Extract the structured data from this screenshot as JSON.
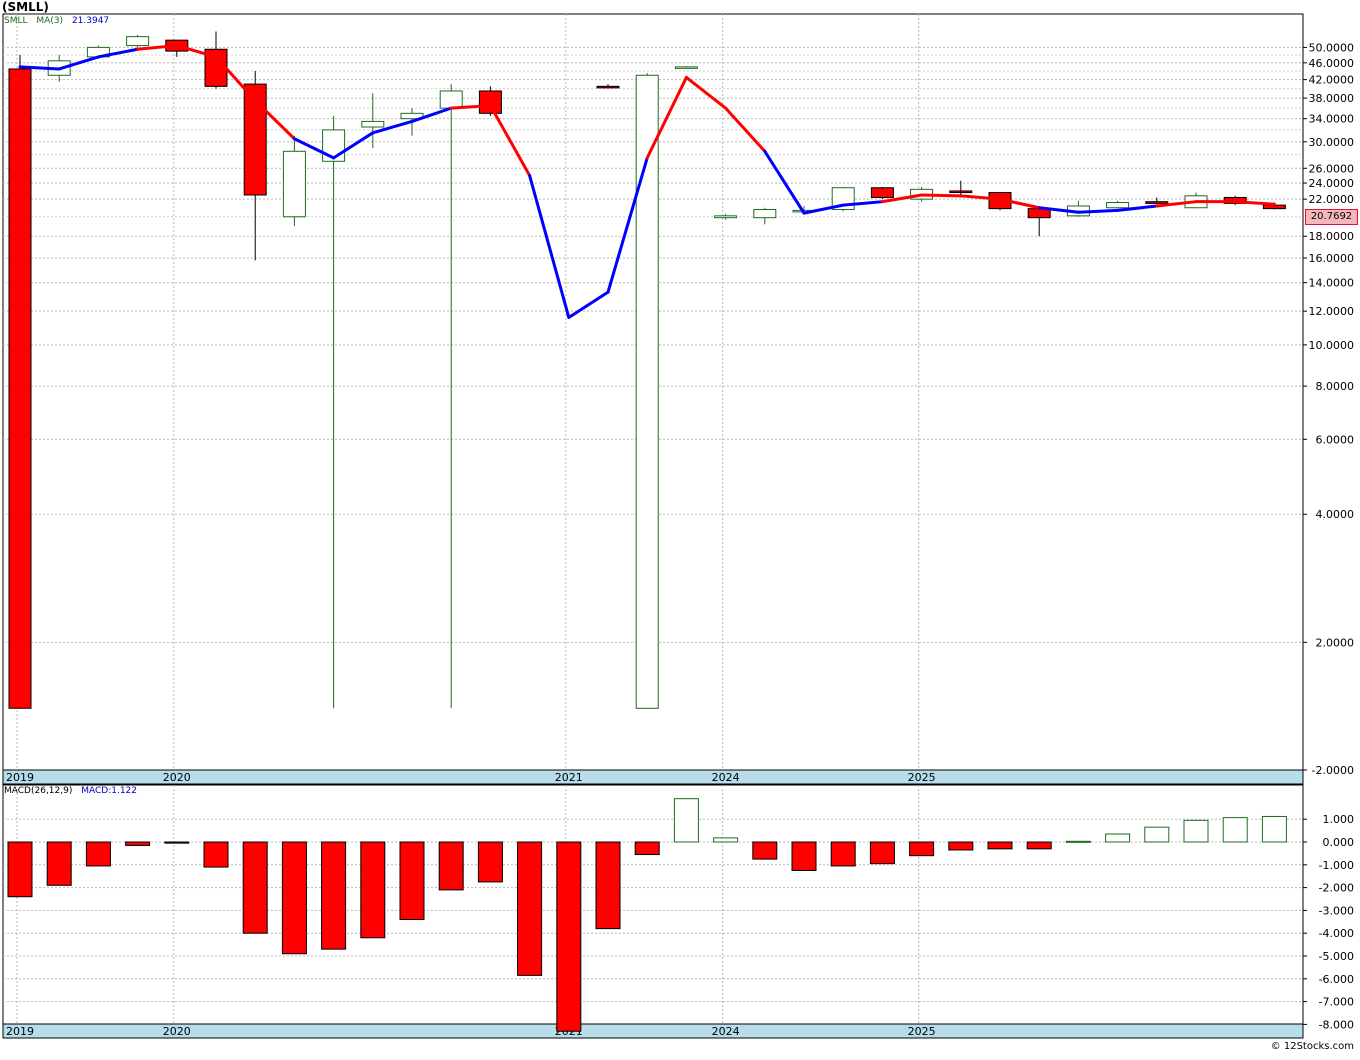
{
  "title": "(SMLL)",
  "price_legend": {
    "symbol": "SMLL",
    "ma_label": "MA(3)",
    "ma_value": "21.3947"
  },
  "macd_legend": {
    "params": "MACD(26,12,9)",
    "value": "MACD:1.122"
  },
  "current_price": "20.7692",
  "credit": "© 12Stocks.com",
  "colors": {
    "up": "#ffffff",
    "up_border": "#1e6b1e",
    "down": "#ff0000",
    "ma_up": "#0000ff",
    "ma_down": "#ff0000",
    "grid": "#b8b8b8",
    "axis_band": "#b7dcea",
    "current_box": "#f4b8b8"
  },
  "chart_data": [
    {
      "type": "candlestick",
      "y_scale": "log",
      "y_ticks": [
        "50.0000",
        "46.0000",
        "42.0000",
        "38.0000",
        "34.0000",
        "30.0000",
        "26.0000",
        "24.0000",
        "22.0000",
        "18.0000",
        "16.0000",
        "14.0000",
        "12.0000",
        "10.0000",
        "8.0000",
        "6.0000",
        "4.0000",
        "2.0000",
        "-2.0000"
      ],
      "x_labels": [
        {
          "i": 0,
          "label": "2019"
        },
        {
          "i": 4,
          "label": "2020"
        },
        {
          "i": 14,
          "label": "2021"
        },
        {
          "i": 18,
          "label": "2024"
        },
        {
          "i": 23,
          "label": "2025"
        }
      ],
      "candles": [
        {
          "o": 44.5,
          "h": 48,
          "l": 1.4,
          "c": 1.4
        },
        {
          "o": 43,
          "h": 48,
          "l": 41.5,
          "c": 46.5
        },
        {
          "o": 47.5,
          "h": 50.5,
          "l": 47,
          "c": 50
        },
        {
          "o": 50.5,
          "h": 53.5,
          "l": 50,
          "c": 53
        },
        {
          "o": 52,
          "h": 52,
          "l": 47.5,
          "c": 49
        },
        {
          "o": 49.5,
          "h": 54.5,
          "l": 40,
          "c": 40.5
        },
        {
          "o": 41,
          "h": 44,
          "l": 15.8,
          "c": 22.5
        },
        {
          "o": 20,
          "h": 31,
          "l": 19,
          "c": 28.5
        },
        {
          "o": 27,
          "h": 34.5,
          "l": 1.4,
          "c": 32
        },
        {
          "o": 32.5,
          "h": 39,
          "l": 29,
          "c": 33.5
        },
        {
          "o": 34,
          "h": 36,
          "l": 31,
          "c": 35
        },
        {
          "o": 36,
          "h": 41,
          "l": 1.4,
          "c": 39.5
        },
        {
          "o": 39.5,
          "h": 40.5,
          "l": 34.5,
          "c": 35
        },
        {
          "o": null,
          "h": null,
          "l": null,
          "c": null
        },
        {
          "o": null,
          "h": null,
          "l": null,
          "c": null
        },
        {
          "o": 40.5,
          "h": 41,
          "l": 40,
          "c": 40.2
        },
        {
          "o": 1.4,
          "h": 43.5,
          "l": 1.4,
          "c": 43
        },
        {
          "o": 44.8,
          "h": 45.2,
          "l": 44.6,
          "c": 45
        },
        {
          "o": 19.9,
          "h": 20.3,
          "l": 19.7,
          "c": 20.1
        },
        {
          "o": 19.9,
          "h": 21,
          "l": 19.2,
          "c": 20.8
        },
        {
          "o": 20.6,
          "h": 21.2,
          "l": 20.3,
          "c": 20.7
        },
        {
          "o": 20.8,
          "h": 23.5,
          "l": 20.6,
          "c": 23.4
        },
        {
          "o": 23.4,
          "h": 23.5,
          "l": 22,
          "c": 22.2
        },
        {
          "o": 22,
          "h": 23.5,
          "l": 21.7,
          "c": 23.2
        },
        {
          "o": 23,
          "h": 24.3,
          "l": 22.5,
          "c": 22.8
        },
        {
          "o": 22.8,
          "h": 22.8,
          "l": 20.7,
          "c": 20.9
        },
        {
          "o": 20.9,
          "h": 20.9,
          "l": 18,
          "c": 19.9
        },
        {
          "o": 20.1,
          "h": 21.8,
          "l": 20,
          "c": 21.2
        },
        {
          "o": 21,
          "h": 21.8,
          "l": 21,
          "c": 21.6
        },
        {
          "o": 21.7,
          "h": 22.2,
          "l": 21.4,
          "c": 21.5
        },
        {
          "o": 21,
          "h": 22.8,
          "l": 21,
          "c": 22.4
        },
        {
          "o": 22.2,
          "h": 22.4,
          "l": 21.3,
          "c": 21.5
        },
        {
          "o": 21.3,
          "h": 21.6,
          "l": 20.8,
          "c": 20.9
        }
      ],
      "ma": [
        {
          "i": 0,
          "v": 45,
          "dir": "down"
        },
        {
          "i": 1,
          "v": 44.5,
          "dir": "up"
        },
        {
          "i": 2,
          "v": 47.5,
          "dir": "up"
        },
        {
          "i": 3,
          "v": 49.5,
          "dir": "up"
        },
        {
          "i": 4,
          "v": 50.5,
          "dir": "down"
        },
        {
          "i": 5,
          "v": 47.5,
          "dir": "down"
        },
        {
          "i": 6,
          "v": 37.5,
          "dir": "down"
        },
        {
          "i": 7,
          "v": 30.5,
          "dir": "down"
        },
        {
          "i": 8,
          "v": 27.5,
          "dir": "up"
        },
        {
          "i": 9,
          "v": 31.5,
          "dir": "up"
        },
        {
          "i": 10,
          "v": 33.5,
          "dir": "up"
        },
        {
          "i": 11,
          "v": 36,
          "dir": "up"
        },
        {
          "i": 12,
          "v": 36.5,
          "dir": "down"
        },
        {
          "i": 13,
          "v": 25,
          "dir": "down"
        },
        {
          "i": 14,
          "v": 11.6,
          "dir": "up"
        },
        {
          "i": 15,
          "v": 13.3,
          "dir": "up"
        },
        {
          "i": 16,
          "v": 27.5,
          "dir": "up"
        },
        {
          "i": 17,
          "v": 42.5,
          "dir": "down"
        },
        {
          "i": 18,
          "v": 36,
          "dir": "down"
        },
        {
          "i": 19,
          "v": 28.5,
          "dir": "down"
        },
        {
          "i": 20,
          "v": 20.4,
          "dir": "up"
        },
        {
          "i": 21,
          "v": 21.3,
          "dir": "up"
        },
        {
          "i": 22,
          "v": 21.7,
          "dir": "up"
        },
        {
          "i": 23,
          "v": 22.5,
          "dir": "down"
        },
        {
          "i": 24,
          "v": 22.4,
          "dir": "down"
        },
        {
          "i": 25,
          "v": 22,
          "dir": "down"
        },
        {
          "i": 26,
          "v": 21,
          "dir": "down"
        },
        {
          "i": 27,
          "v": 20.5,
          "dir": "up"
        },
        {
          "i": 28,
          "v": 20.7,
          "dir": "up"
        },
        {
          "i": 29,
          "v": 21.2,
          "dir": "up"
        },
        {
          "i": 30,
          "v": 21.7,
          "dir": "down"
        },
        {
          "i": 31,
          "v": 21.7,
          "dir": "down"
        },
        {
          "i": 32,
          "v": 21.4,
          "dir": "down"
        }
      ]
    },
    {
      "type": "bar",
      "title": "MACD(26,12,9)",
      "y_ticks": [
        "1.000",
        "0.000",
        "-1.000",
        "-2.000",
        "-3.000",
        "-4.000",
        "-5.000",
        "-6.000",
        "-7.000",
        "-8.000"
      ],
      "ylim": [
        -8.3,
        1.75
      ],
      "values": [
        -2.4,
        -1.9,
        -1.05,
        -0.15,
        -0.05,
        -1.1,
        -4.0,
        -4.9,
        -4.7,
        -4.2,
        -3.4,
        -2.1,
        -1.75,
        -5.85,
        -8.3,
        -3.8,
        -0.55,
        1.9,
        0.18,
        -0.75,
        -1.25,
        -1.05,
        -0.95,
        -0.6,
        -0.35,
        -0.3,
        -0.3,
        0.03,
        0.35,
        0.65,
        0.95,
        1.07,
        1.12
      ]
    }
  ]
}
